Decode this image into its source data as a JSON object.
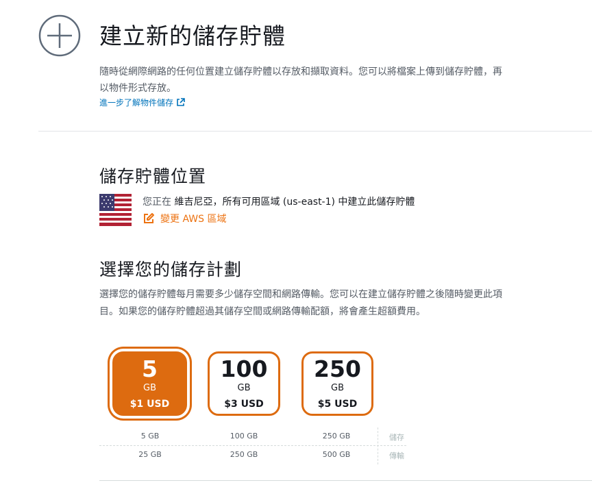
{
  "header": {
    "title": "建立新的儲存貯體",
    "icon": "plus-circle-icon",
    "description": "隨時從網際網路的任何位置建立儲存貯體以存放和擷取資料。您可以將檔案上傳到儲存貯體，再以物件形式存放。",
    "learn_more_link": "進一步了解物件儲存"
  },
  "location": {
    "title": "儲存貯體位置",
    "flag": "us-flag-icon",
    "prefix": "您正在",
    "region_text": "維吉尼亞，所有可用區域 (us-east-1) 中建立此儲存貯體",
    "change_label": "變更 AWS 區域"
  },
  "plan": {
    "title": "選擇您的儲存計劃",
    "description": "選擇您的儲存貯體每月需要多少儲存空間和網路傳輸。您可以在建立儲存貯體之後隨時變更此項目。如果您的儲存貯體超過其儲存空間或網路傳輸配額，將會產生超額費用。",
    "options": [
      {
        "size": "5",
        "unit": "GB",
        "price": "$1 USD",
        "storage": "5 GB",
        "transfer": "25 GB",
        "selected": true
      },
      {
        "size": "100",
        "unit": "GB",
        "price": "$3 USD",
        "storage": "100 GB",
        "transfer": "250 GB",
        "selected": false
      },
      {
        "size": "250",
        "unit": "GB",
        "price": "$5 USD",
        "storage": "250 GB",
        "transfer": "500 GB",
        "selected": false
      }
    ],
    "storage_label": "儲存",
    "transfer_label": "傳輸"
  },
  "colors": {
    "accent": "#dd6b10",
    "link": "#0073bb",
    "text": "#16191f",
    "muted": "#545b64"
  }
}
